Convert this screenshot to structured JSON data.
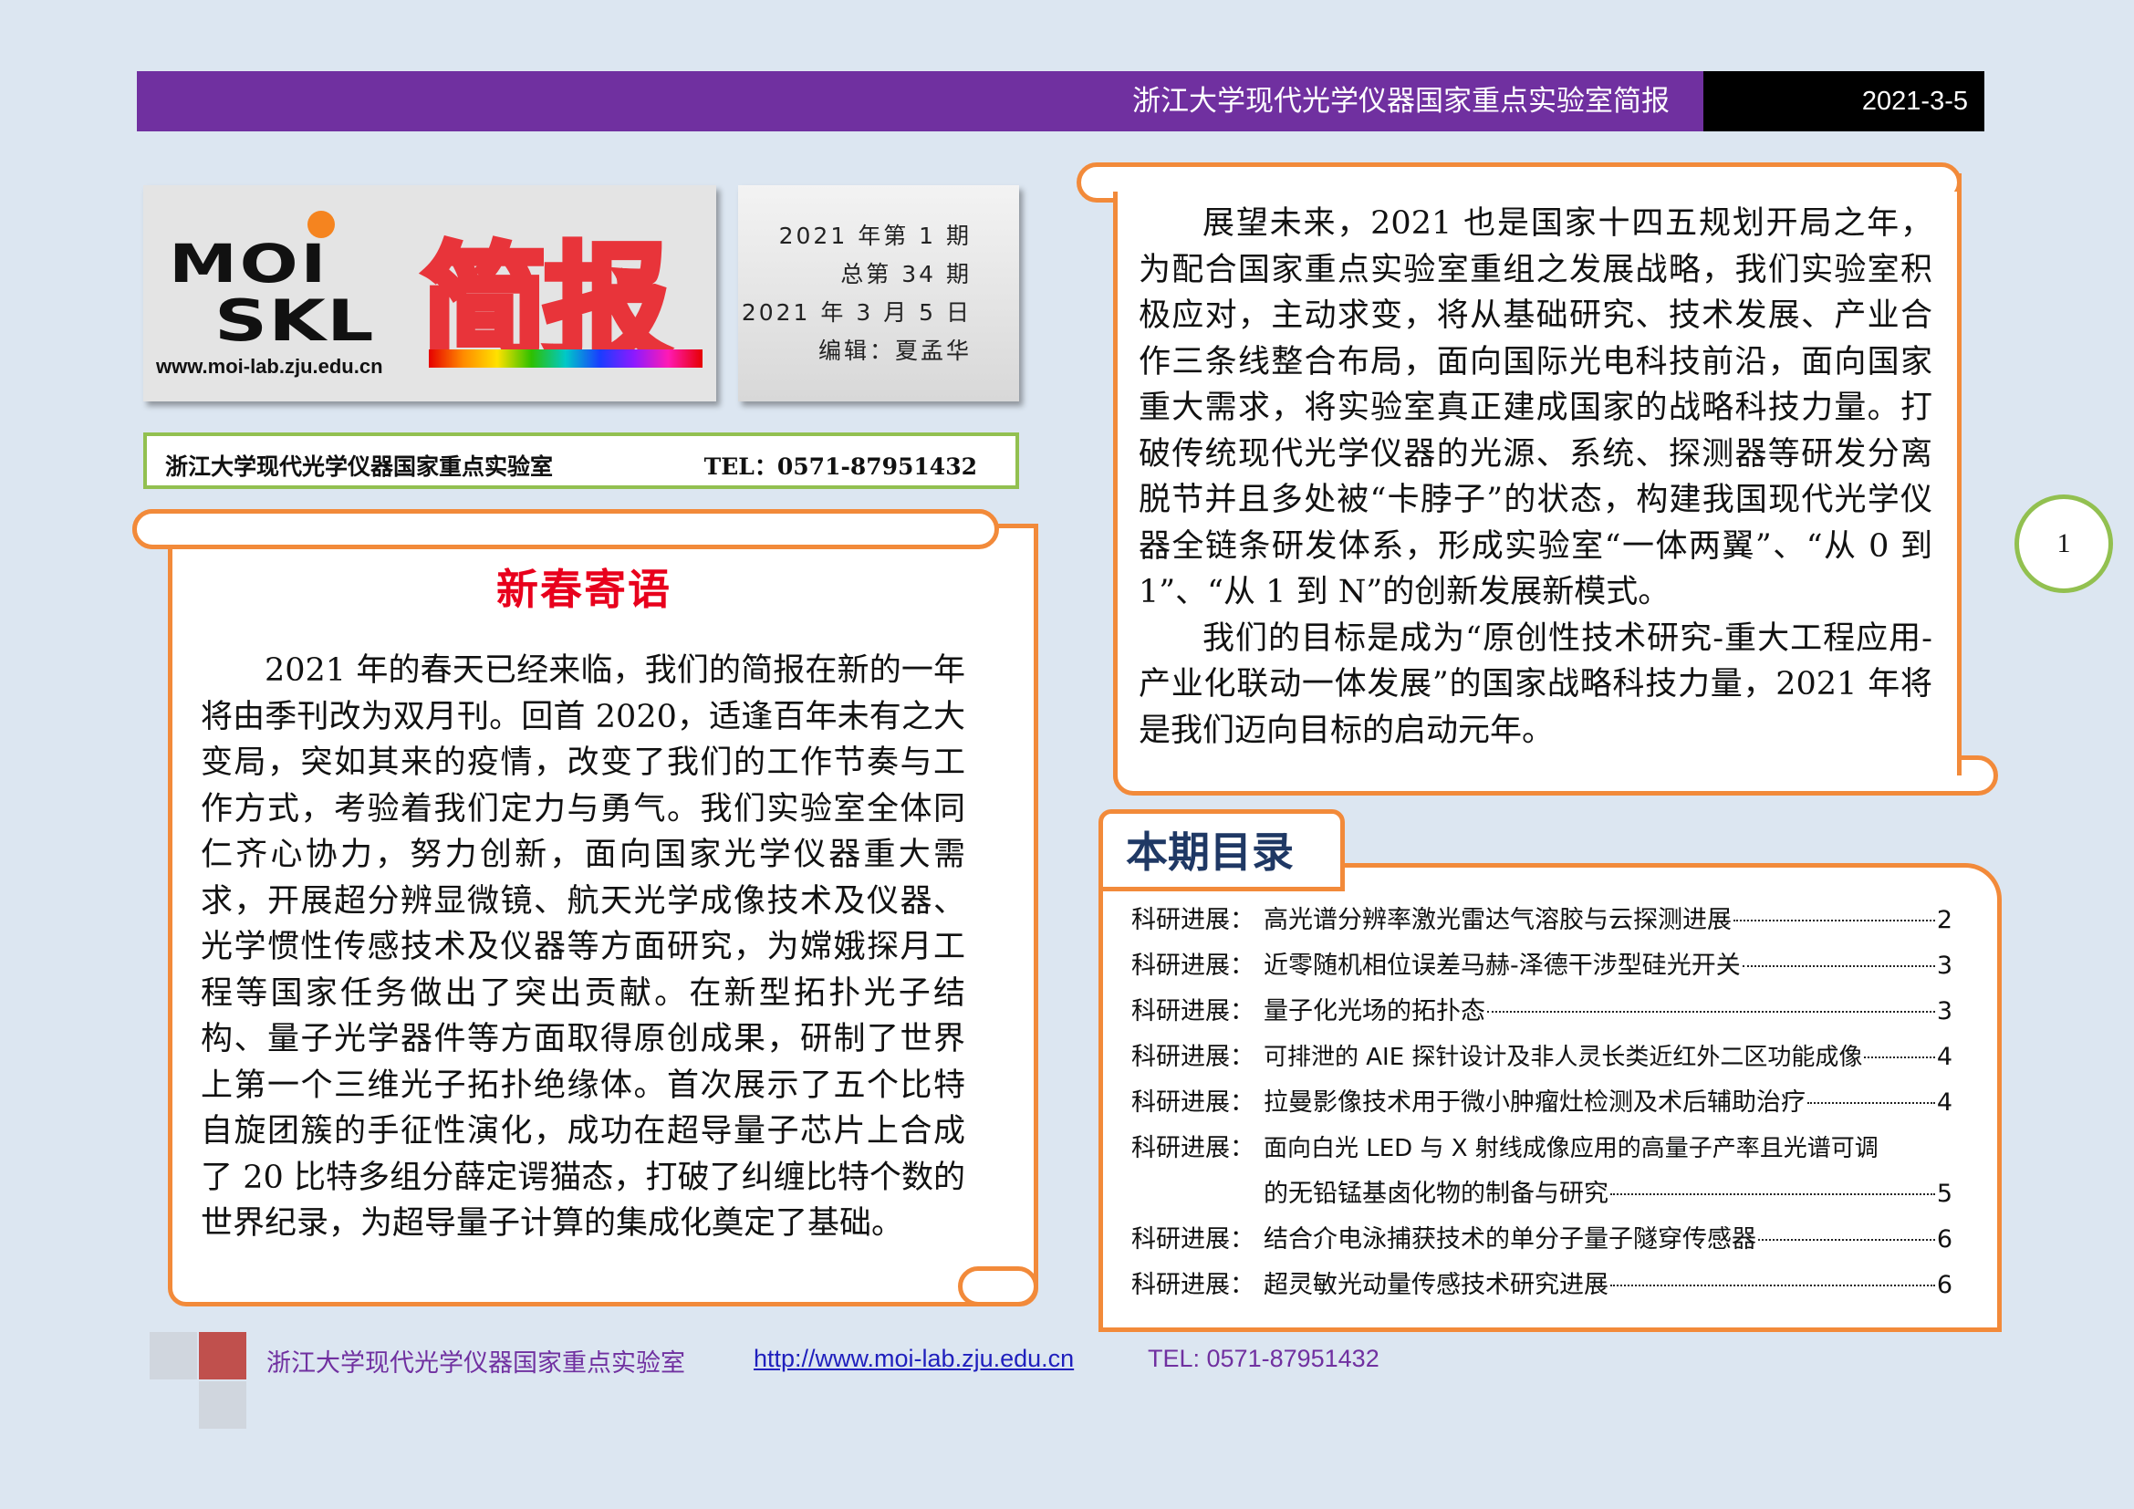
{
  "header": {
    "title": "浙江大学现代光学仪器国家重点实验室简报",
    "date": "2021-3-5"
  },
  "masthead": {
    "logo_moi": "MOI",
    "logo_skl": "SKL",
    "url": "www.moi-lab.zju.edu.cn",
    "title": "简报"
  },
  "issue": {
    "line1": "2021 年第 1  期",
    "line2": "总第 34 期",
    "line3": "2021 年 3 月 5 日",
    "line4": "编辑：夏孟华"
  },
  "lab_bar": {
    "name": "浙江大学现代光学仪器国家重点实验室",
    "tel": "TEL：0571-87951432"
  },
  "greeting": {
    "title": "新春寄语",
    "text": "2021 年的春天已经来临，我们的简报在新的一年将由季刊改为双月刊。回首 2020，适逢百年未有之大变局，突如其来的疫情，改变了我们的工作节奏与工作方式，考验着我们定力与勇气。我们实验室全体同仁齐心协力，努力创新，面向国家光学仪器重大需求，开展超分辨显微镜、航天光学成像技术及仪器、光学惯性传感技术及仪器等方面研究，为嫦娥探月工程等国家任务做出了突出贡献。在新型拓扑光子结构、量子光学器件等方面取得原创成果，研制了世界上第一个三维光子拓扑绝缘体。首次展示了五个比特自旋团簇的手征性演化，成功在超导量子芯片上合成了 20 比特多组分薛定谔猫态，打破了纠缠比特个数的世界纪录，为超导量子计算的集成化奠定了基础。"
  },
  "outlook": {
    "para1": "展望未来，2021 也是国家十四五规划开局之年，为配合国家重点实验室重组之发展战略，我们实验室积极应对，主动求变，将从基础研究、技术发展、产业合作三条线整合布局，面向国际光电科技前沿，面向国家重大需求，将实验室真正建成国家的战略科技力量。打破传统现代光学仪器的光源、系统、探测器等研发分离脱节并且多处被“卡脖子”的状态，构建我国现代光学仪器全链条研发体系，形成实验室“一体两翼”、“从 0 到 1”、“从 1 到 N”的创新发展新模式。",
    "para2": "我们的目标是成为“原创性技术研究-重大工程应用-产业化联动一体发展”的国家战略科技力量，2021 年将是我们迈向目标的启动元年。"
  },
  "page_number": "1",
  "toc": {
    "title": "本期目录",
    "items": [
      {
        "category": "科研进展：",
        "text": "高光谱分辨率激光雷达气溶胶与云探测进展",
        "page": "2"
      },
      {
        "category": "科研进展：",
        "text": "近零随机相位误差马赫-泽德干涉型硅光开关",
        "page": "3"
      },
      {
        "category": "科研进展：",
        "text": "量子化光场的拓扑态",
        "page": "3"
      },
      {
        "category": "科研进展：",
        "text": "可排泄的 AIE 探针设计及非人灵长类近红外二区功能成像",
        "page": "4"
      },
      {
        "category": "科研进展：",
        "text": "拉曼影像技术用于微小肿瘤灶检测及术后辅助治疗",
        "page": "4"
      },
      {
        "category": "科研进展：",
        "text": "面向白光 LED 与 X 射线成像应用的高量子产率且光谱可调",
        "page": ""
      },
      {
        "category": "",
        "text": "的无铅锰基卤化物的制备与研究",
        "page": "5"
      },
      {
        "category": "科研进展：",
        "text": "结合介电泳捕获技术的单分子量子隧穿传感器",
        "page": "6"
      },
      {
        "category": "科研进展：",
        "text": "超灵敏光动量传感技术研究进展",
        "page": "6"
      }
    ]
  },
  "footer": {
    "name": "浙江大学现代光学仪器国家重点实验室",
    "url": "http://www.moi-lab.zju.edu.cn",
    "tel": "TEL: 0571-87951432"
  }
}
